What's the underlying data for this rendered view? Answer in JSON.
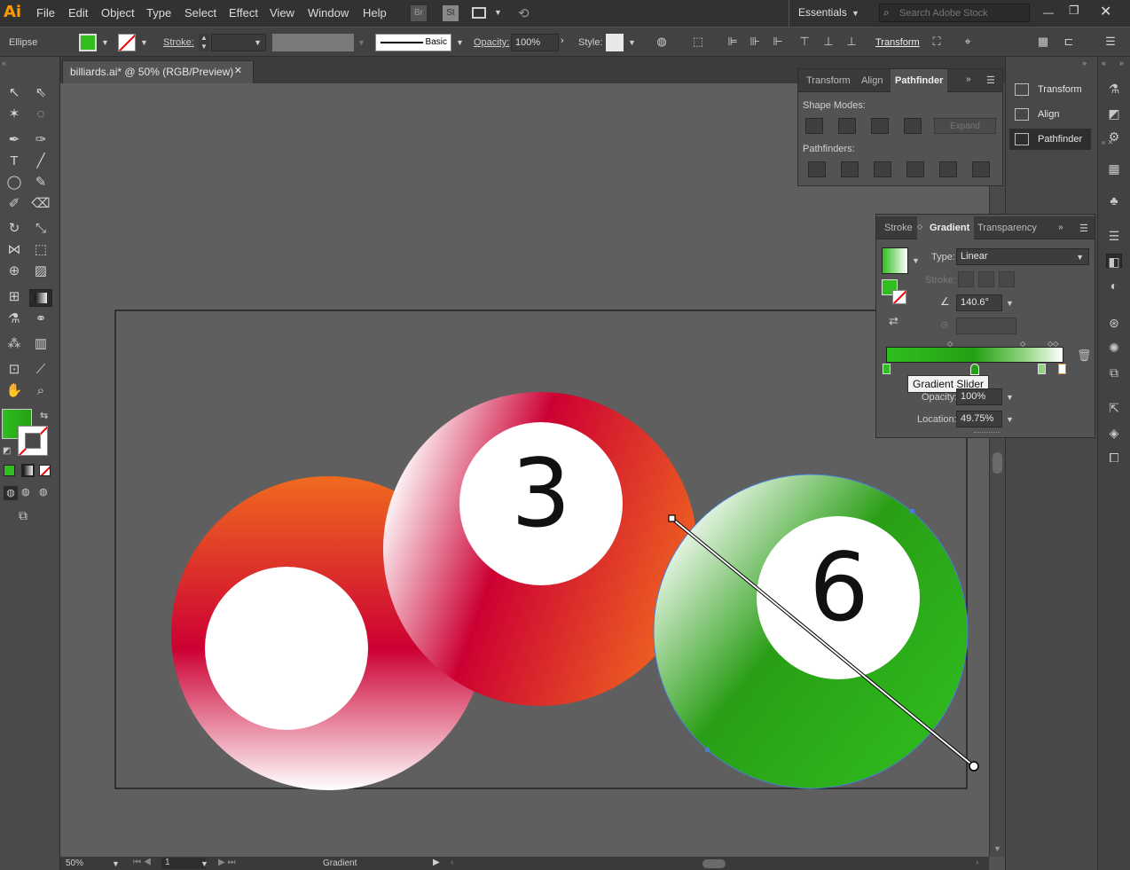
{
  "app": {
    "logo": "Ai"
  },
  "menu": [
    "File",
    "Edit",
    "Object",
    "Type",
    "Select",
    "Effect",
    "View",
    "Window",
    "Help"
  ],
  "menu_right": {
    "bridge": "Br",
    "stock": "St",
    "workspace": "Essentials",
    "search_placeholder": "Search Adobe Stock"
  },
  "control": {
    "selection": "Ellipse",
    "stroke_label": "Stroke:",
    "brush": "Basic",
    "opacity_label": "Opacity:",
    "opacity": "100%",
    "style_label": "Style:",
    "transform": "Transform"
  },
  "doc": {
    "tab": "billiards.ai* @ 50% (RGB/Preview)"
  },
  "canvas": {
    "ball3": "3",
    "ball6": "6"
  },
  "status": {
    "zoom": "50%",
    "artboard": "1",
    "tool": "Gradient"
  },
  "pathfinder": {
    "tabs": [
      "Transform",
      "Align",
      "Pathfinder"
    ],
    "shape_modes": "Shape Modes:",
    "expand": "Expand",
    "pathfinders": "Pathfinders:"
  },
  "dock": {
    "items": [
      "Transform",
      "Align",
      "Pathfinder"
    ]
  },
  "gradient": {
    "tabs": [
      "Stroke",
      "Gradient",
      "Transparency"
    ],
    "type_label": "Type:",
    "type": "Linear",
    "stroke_label": "Stroke:",
    "angle": "140.6°",
    "tooltip": "Gradient Slider",
    "opacity_label": "Opacity:",
    "opacity": "100%",
    "location_label": "Location:",
    "location": "49.75%"
  },
  "colors": {
    "fill": "#2fbe1e",
    "green_dark": "#229a10",
    "red": "#cc0033",
    "orange": "#f06a1f",
    "bg": "#535353"
  }
}
